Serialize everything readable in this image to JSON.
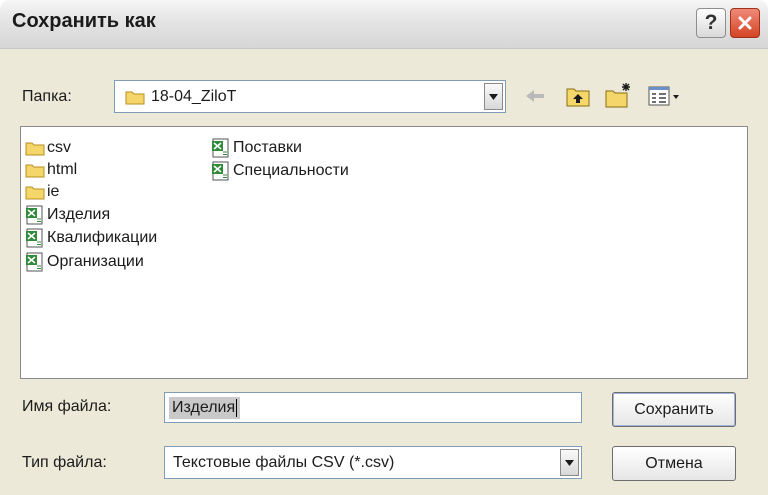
{
  "window": {
    "title": "Сохранить как",
    "help_label": "?"
  },
  "folder": {
    "label": "Папка:",
    "current": "18-04_ZiloT"
  },
  "toolbar": {
    "icons": [
      "back-arrow-icon",
      "up-folder-icon",
      "new-folder-icon",
      "view-menu-icon"
    ]
  },
  "files": [
    {
      "name": "csv",
      "type": "folder"
    },
    {
      "name": "html",
      "type": "folder"
    },
    {
      "name": "ie",
      "type": "folder"
    },
    {
      "name": "Изделия",
      "type": "csv"
    },
    {
      "name": "Квалификации",
      "type": "csv"
    },
    {
      "name": "Организации",
      "type": "csv"
    },
    {
      "name": "Поставки",
      "type": "csv"
    },
    {
      "name": "Специальности",
      "type": "csv"
    }
  ],
  "form": {
    "filename_label": "Имя файла:",
    "filename_value": "Изделия",
    "filetype_label": "Тип файла:",
    "filetype_value": "Текстовые файлы CSV (*.csv)"
  },
  "buttons": {
    "save": "Сохранить",
    "cancel": "Отмена"
  },
  "colors": {
    "dialog_bg": "#ece9d8",
    "close_red": "#d44425",
    "folder_yellow": "#f5d66a",
    "excel_green": "#2f8a3a"
  }
}
